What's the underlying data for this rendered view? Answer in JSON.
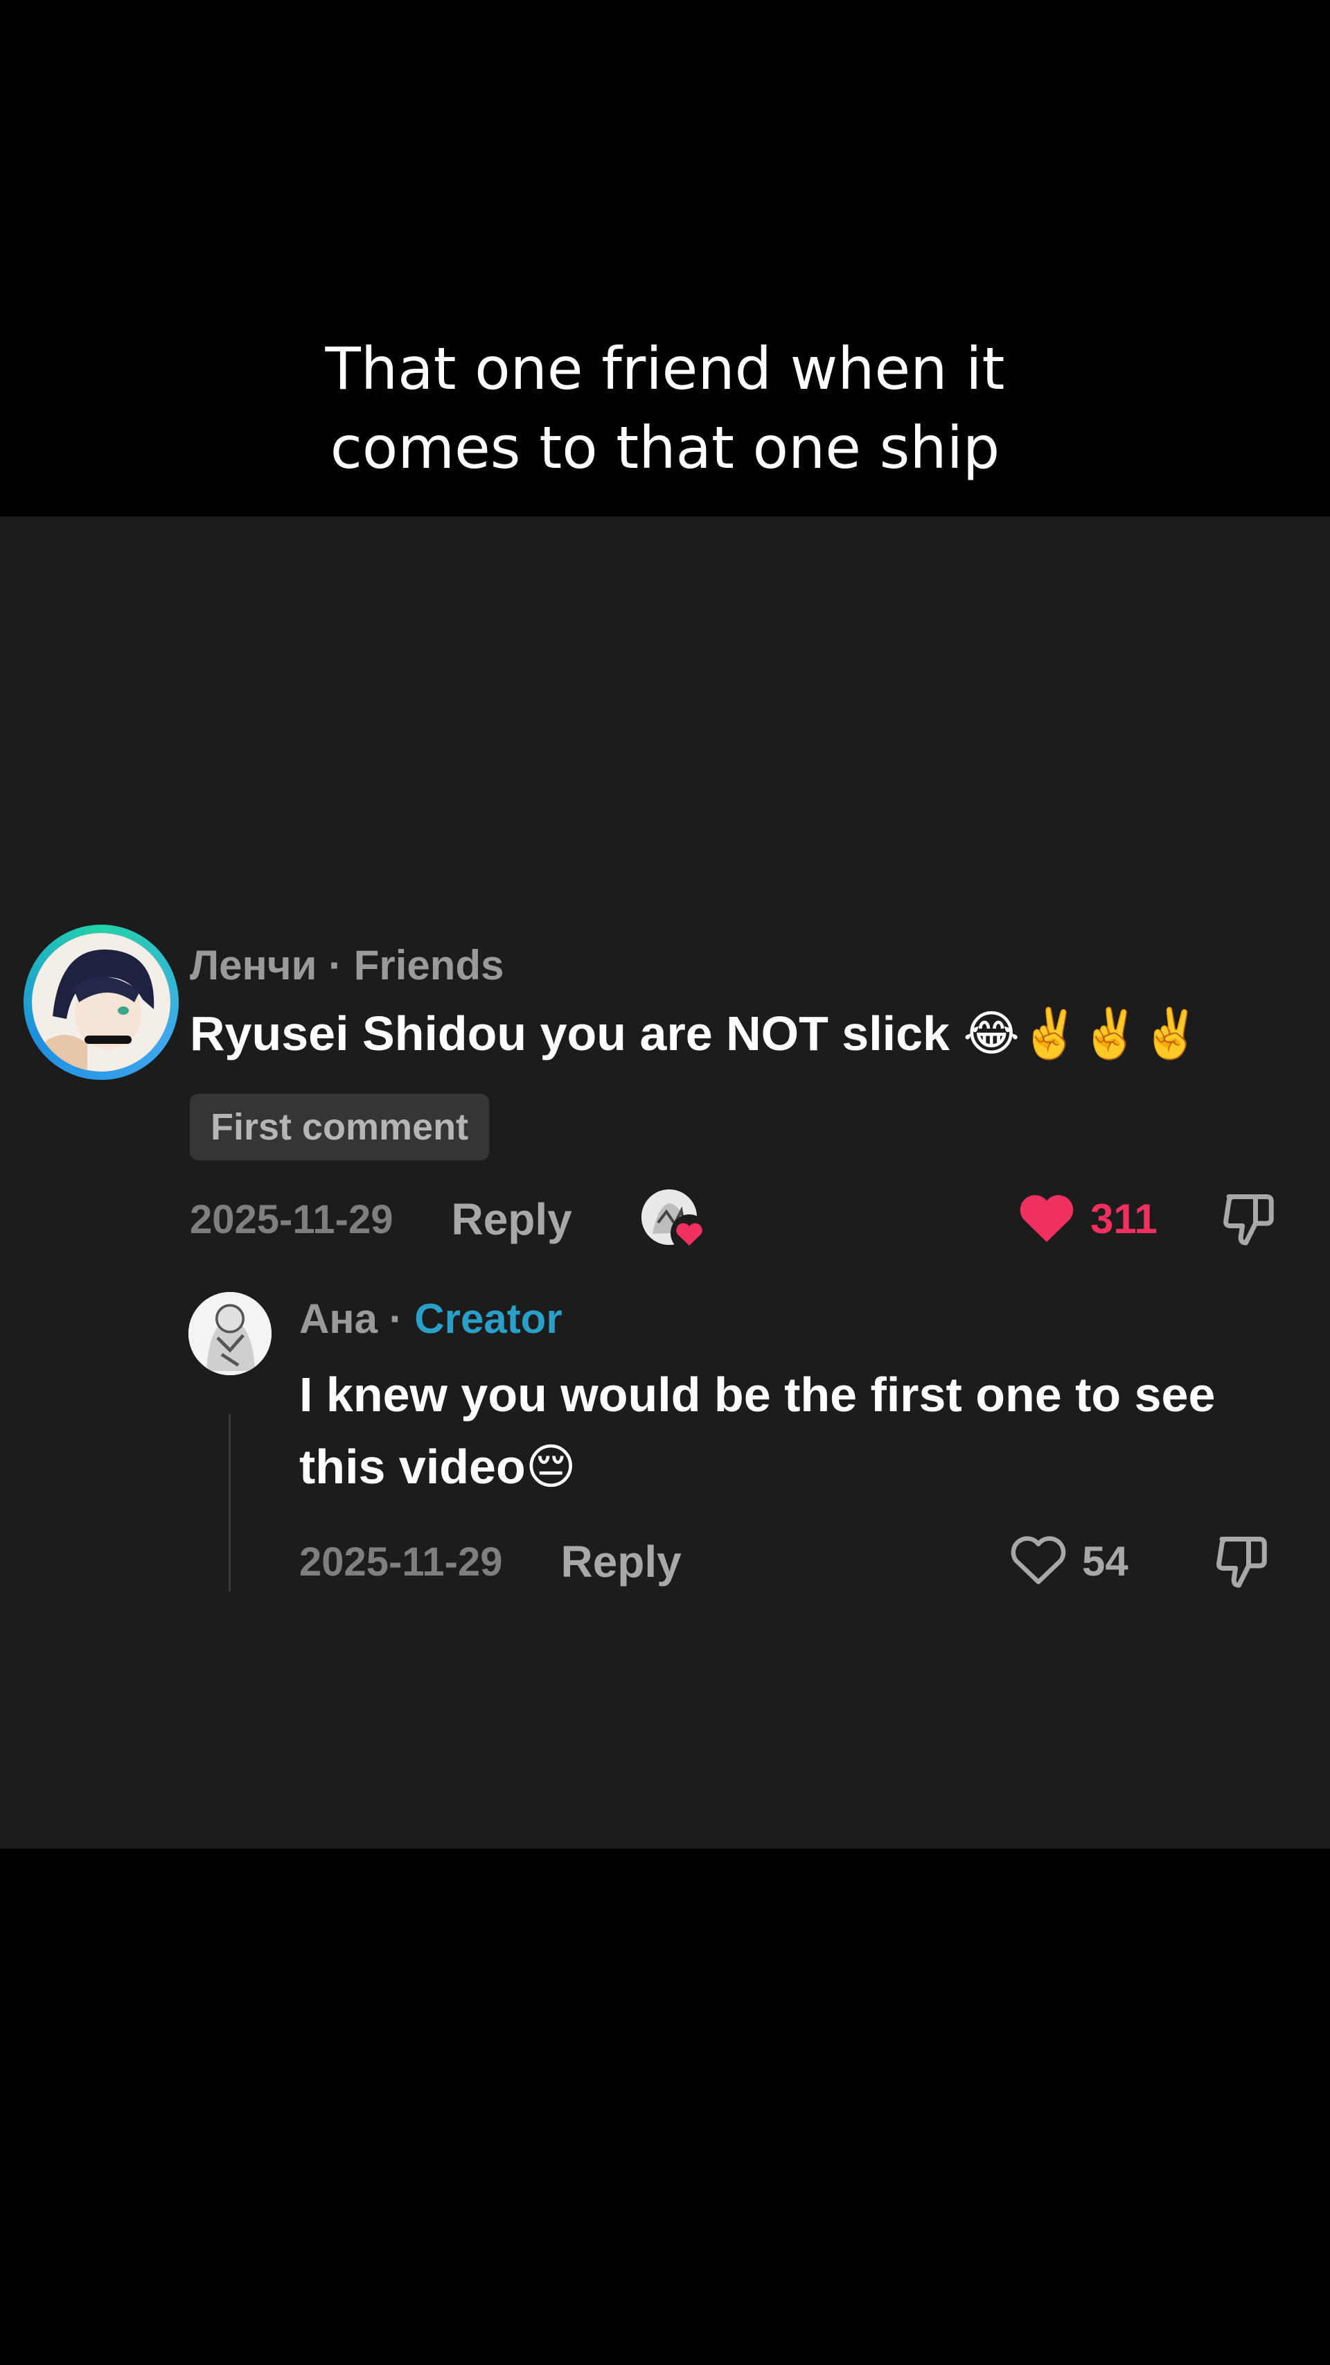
{
  "caption": {
    "text": "That one friend when it\ncomes to that one ship"
  },
  "comment": {
    "username": "Ленчи",
    "separator": " · ",
    "relation": "Friends",
    "text": "Ryusei Shidou you are NOT slick 😂✌️✌️✌️",
    "badge": "First comment",
    "date": "2025-11-29",
    "reply_label": "Reply",
    "like_count": "311",
    "liked": true,
    "like_icon": "heart-filled-icon",
    "dislike_icon": "thumbs-down-icon",
    "creator_liked_icon": "creator-liked-heart-icon"
  },
  "reply": {
    "username": "Ана",
    "separator": " · ",
    "role": "Creator",
    "text": "I knew you would be the first one to see this video😔",
    "date": "2025-11-29",
    "reply_label": "Reply",
    "like_count": "54",
    "liked": false,
    "like_icon": "heart-outline-icon",
    "dislike_icon": "thumbs-down-icon"
  },
  "colors": {
    "like_red": "#f0305e",
    "creator_blue": "#2aa0c8",
    "panel_bg": "#1c1c1c",
    "page_bg": "#000000"
  }
}
